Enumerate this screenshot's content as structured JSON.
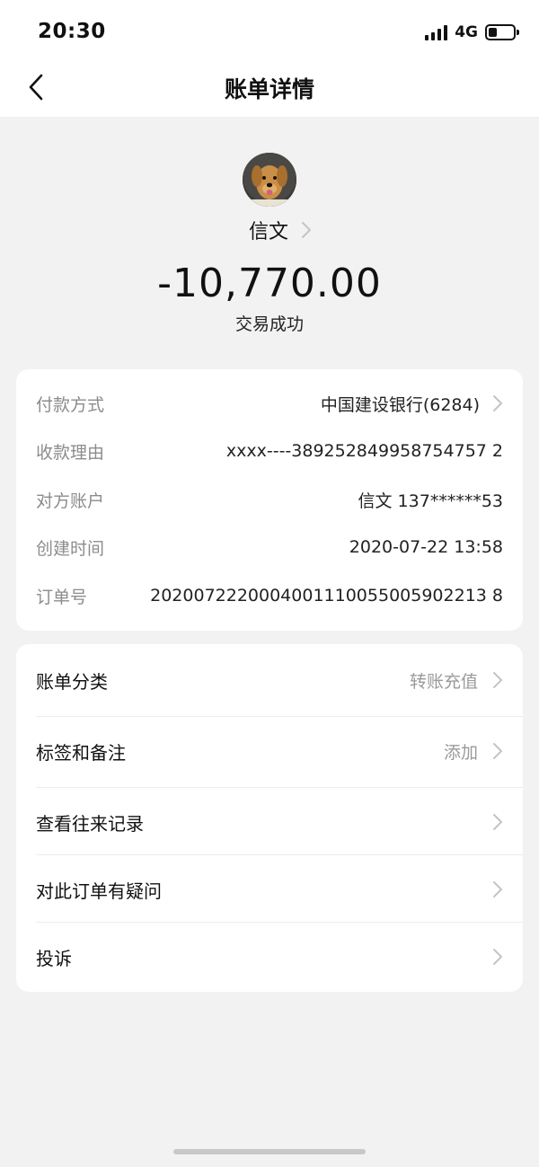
{
  "status_bar": {
    "time": "20:30",
    "network": "4G",
    "battery_level": 0.3
  },
  "nav": {
    "title": "账单详情",
    "back_icon": "chevron-left-icon"
  },
  "counterparty": {
    "name": "信文",
    "avatar": "dog-avatar"
  },
  "transaction": {
    "amount": "-10,770.00",
    "status": "交易成功"
  },
  "details": [
    {
      "label": "付款方式",
      "value": "中国建设银行(6284)",
      "has_arrow": true
    },
    {
      "label": "收款理由",
      "value": "xxxx----389252849958754757 2"
    },
    {
      "label": "对方账户",
      "value": "信文 137******53"
    },
    {
      "label": "创建时间",
      "value": "2020-07-22 13:58"
    },
    {
      "label": "订单号",
      "value": "2020072220004001110055005902213 8"
    }
  ],
  "actions": [
    {
      "label": "账单分类",
      "value": "转账充值"
    },
    {
      "label": "标签和备注",
      "value": "添加"
    },
    {
      "label": "查看往来记录",
      "value": ""
    },
    {
      "label": "对此订单有疑问",
      "value": ""
    },
    {
      "label": "投诉",
      "value": ""
    }
  ],
  "colors": {
    "background": "#f2f2f2",
    "card": "#ffffff",
    "label_gray": "#8c8c8c",
    "chevron": "#c4c4c4"
  }
}
